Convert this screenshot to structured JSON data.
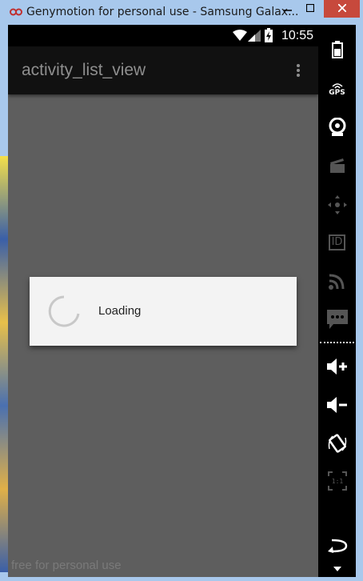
{
  "window": {
    "title": "Genymotion for personal use - Samsung Galax...",
    "colors": {
      "frame": "#a8c8ec",
      "close": "#c7493c"
    }
  },
  "statusbar": {
    "time": "10:55"
  },
  "actionbar": {
    "title": "activity_list_view"
  },
  "dialog": {
    "message": "Loading"
  },
  "watermark": "free for personal use",
  "sidebar": {
    "icons": [
      "battery-icon",
      "gps-icon",
      "camera-icon",
      "video-capture-icon",
      "dpad-icon",
      "id-icon",
      "cast-icon",
      "sms-icon",
      "volume-up-icon",
      "volume-down-icon",
      "rotate-icon",
      "pixel-perfect-icon",
      "back-icon",
      "menu-down-icon"
    ],
    "gps_label": "GPS",
    "id_label": "ID",
    "ratio_label": "1:1"
  }
}
